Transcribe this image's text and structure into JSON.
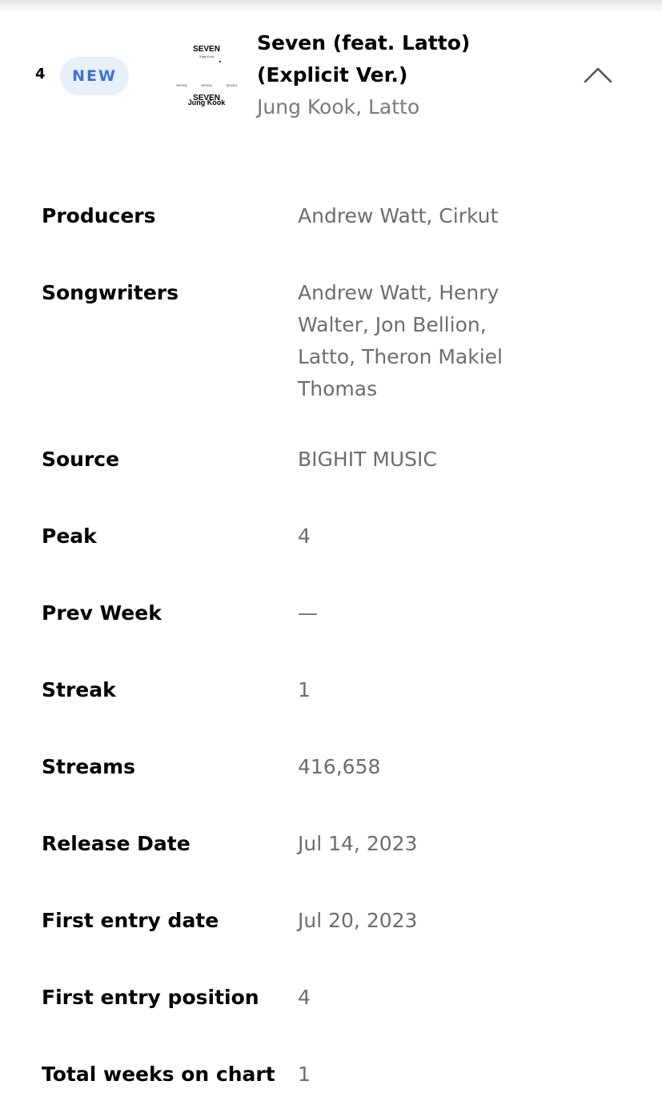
{
  "entry": {
    "rank": "4",
    "badge": "NEW",
    "title": "Seven (feat. Latto) (Explicit Ver.)",
    "artist": "Jung Kook, Latto",
    "expanded": true,
    "icons": {
      "collapse": "chevron-up-icon"
    },
    "cover_art": {
      "title": "SEVEN",
      "subtitle": "Jung Kook",
      "small_labels": [
        "SEVEN",
        "SEVEN",
        "SEVEN",
        "SEVEN",
        "SEVEN"
      ],
      "bottom_title": "SEVEN",
      "bottom_artist": "Jung Kook"
    },
    "colors": {
      "badge_text": "#3a72d8",
      "badge_bg": "#e8f0fb",
      "secondary_text": "#6d6d6d"
    }
  },
  "details": [
    {
      "label": "Producers",
      "value": "Andrew Watt, Cirkut"
    },
    {
      "label": "Songwriters",
      "value": "Andrew Watt, Henry Walter, Jon Bellion, Latto, Theron Makiel Thomas"
    },
    {
      "label": "Source",
      "value": "BIGHIT MUSIC"
    },
    {
      "label": "Peak",
      "value": "4"
    },
    {
      "label": "Prev Week",
      "value": "—"
    },
    {
      "label": "Streak",
      "value": "1"
    },
    {
      "label": "Streams",
      "value": "416,658"
    },
    {
      "label": "Release Date",
      "value": "Jul 14, 2023"
    },
    {
      "label": "First entry date",
      "value": "Jul 20, 2023"
    },
    {
      "label": "First entry position",
      "value": "4"
    },
    {
      "label": "Total weeks on chart",
      "value": "1"
    }
  ]
}
